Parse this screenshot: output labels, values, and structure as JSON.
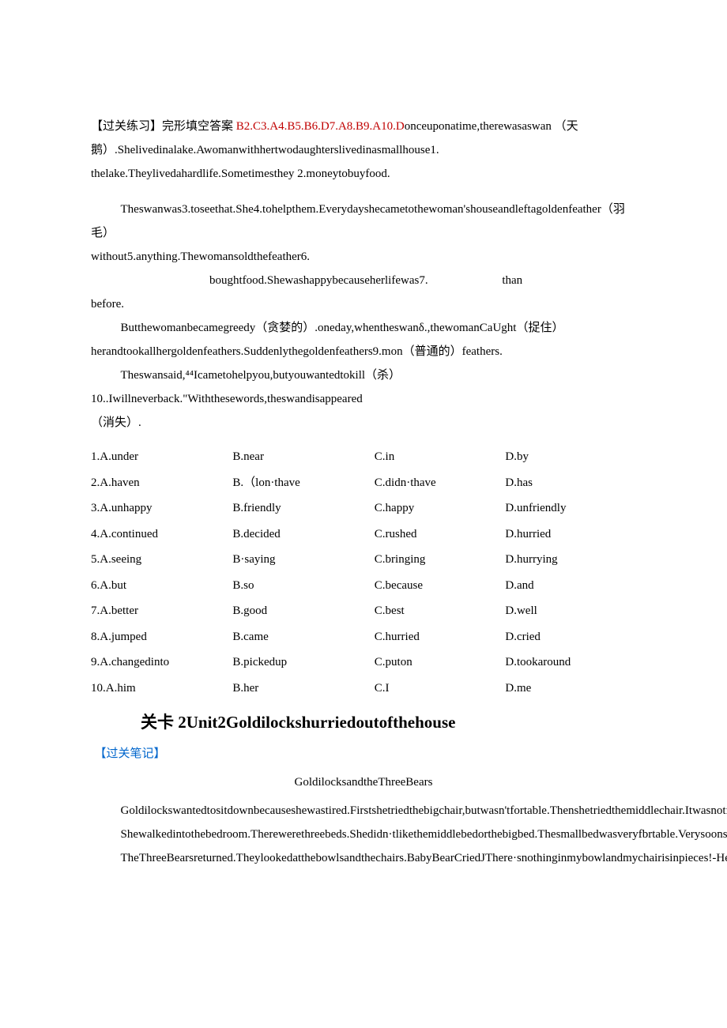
{
  "title_zh": "【过关练习】完形填空答案",
  "answers": "B2.C3.A4.B5.B6.D7.A8.B9.A10.D",
  "intro": "onceuponatime,therewasaswan （天鹅）.Shelivedinalake.Awomanwithhertwodaughterslivedinasmallhouse1. thelake.Theylivedahardlife.Sometimesthey 2.moneytobuyfood.",
  "p2": "Theswanwas3.toseethat.She4.tohelpthem.Everydayshecametothewoman'shouseandleftagoldenfeather（羽毛）",
  "p2b": "without5.anything.Thewomansoldthefeather6.",
  "p2c": "boughtfood.Shewashappybecauseherlifewas7.",
  "than": "than",
  "before": "before.",
  "p3": "Butthewomanbecamegreedy（贪婪的）.oneday,whentheswanδ.,thewomanCaUght（捉住）",
  "p3b": "herandtookallhergoldenfeathers.Suddenlythegoldenfeathers9.mon（普通的）feathers.",
  "p4": "Theswansaid,⁴⁴Icametohelpyou,butyouwantedtokill（杀）10..Iwillneverback.\"Withthesewords,theswandisappeared",
  "p4b": "（消失）.",
  "opts": [
    {
      "a": "1.A.under",
      "b": "B.near",
      "c": "C.in",
      "d": "D.by"
    },
    {
      "a": "2.A.haven",
      "b": "B.（lon·thave",
      "c": "C.didn·thave",
      "d": "D.has"
    },
    {
      "a": "3.A.unhappy",
      "b": "B.friendly",
      "c": "C.happy",
      "d": "D.unfriendly"
    },
    {
      "a": "4.A.continued",
      "b": "B.decided",
      "c": "C.rushed",
      "d": "D.hurried"
    },
    {
      "a": "5.A.seeing",
      "b": "B·saying",
      "c": "C.bringing",
      "d": "D.hurrying"
    },
    {
      "a": "6.A.but",
      "b": "B.so",
      "c": "C.because",
      "d": "D.and"
    },
    {
      "a": "7.A.better",
      "b": "B.good",
      "c": "C.best",
      "d": "D.well"
    },
    {
      "a": "8.A.jumped",
      "b": "B.came",
      "c": "C.hurried",
      "d": "D.cried"
    },
    {
      "a": "9.A.changedinto",
      "b": "B.pickedup",
      "c": "C.puton",
      "d": "D.tookaround"
    },
    {
      "a": "10.A.him",
      "b": "B.her",
      "c": "C.I",
      "d": "D.me"
    }
  ],
  "unit": "关卡 2Unit2Goldilockshurriedoutofthehouse",
  "notes": "【过关笔记】",
  "storytitle": "GoldilocksandtheThreeBears",
  "s1": "Goldilockswantedtositdownbecauseshewastired.Firstshetriedthebigchair,butwasn'tfortable.Thenshetriedthemiddlechair.Itwasnotfbrtableeither.Finally,shetriedthesmallchair.Itwasniceandfbrtable,butGoldilockswasveryheavyandsoonthechairwasinpieces.",
  "s2": "Shewalkedintothebedroom.Therewerethreebeds.Shedidn·tlikethemiddlebedorthebigbed.Thesmallbedwasveryfbrtable.Verysoonshewasasleepinit.",
  "s3": "TheThreeBearsreturned.Theylookedatthebowlsandthechairs.BabyBearCriedJThere·snothinginmybowlandmychairisinpieces!‑Hewasn'tveryhappy!"
}
